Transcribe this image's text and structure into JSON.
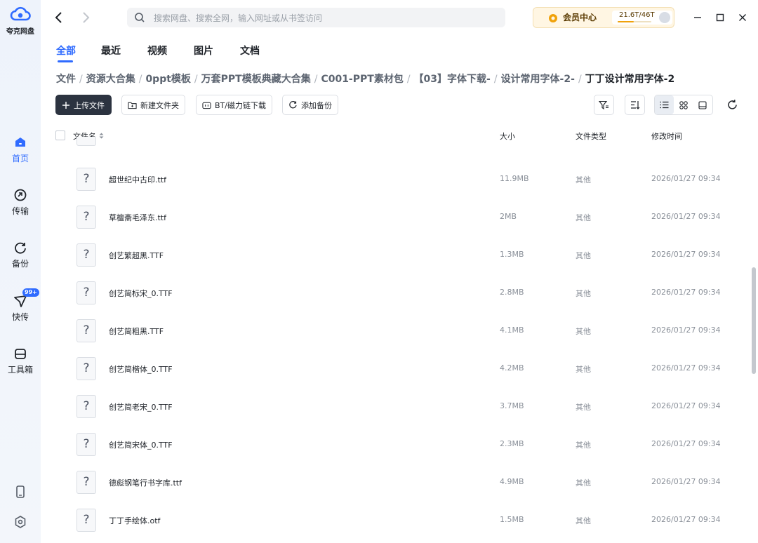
{
  "app": {
    "name": "夸克网盘"
  },
  "sidebar": {
    "items": [
      {
        "label": "首页",
        "icon": "home-icon"
      },
      {
        "label": "传输",
        "icon": "transfer-icon"
      },
      {
        "label": "备份",
        "icon": "backup-icon"
      },
      {
        "label": "快传",
        "icon": "quick-send-icon",
        "badge": "99+"
      },
      {
        "label": "工具箱",
        "icon": "toolbox-icon"
      }
    ],
    "bottom": [
      "phone-icon",
      "settings-icon"
    ]
  },
  "search": {
    "placeholder": "搜索网盘、搜索全网，输入网址或从书签访问"
  },
  "member": {
    "label": "会员中心",
    "storage": "21.6T/46T",
    "storage_used_fraction": 0.47
  },
  "tabs": [
    "全部",
    "最近",
    "视频",
    "图片",
    "文档"
  ],
  "breadcrumb": [
    "文件",
    "资源大合集",
    "0ppt模板",
    "万套PPT模板典藏大合集",
    "C001-PPT素材包",
    "【03】字体下载-",
    "设计常用字体-2-",
    "丁丁设计常用字体-2"
  ],
  "toolbar": {
    "upload": "上传文件",
    "new_folder": "新建文件夹",
    "bt": "BT/磁力链下载",
    "backup": "添加备份"
  },
  "table": {
    "headers": {
      "name": "文件名",
      "size": "大小",
      "type": "文件类型",
      "modified": "修改时间"
    },
    "rows": [
      {
        "name": "超世纪中古印.ttf",
        "size": "11.9MB",
        "type": "其他",
        "modified": "2026/01/27 09:34"
      },
      {
        "name": "草檀斋毛泽东.ttf",
        "size": "2MB",
        "type": "其他",
        "modified": "2026/01/27 09:34"
      },
      {
        "name": "创艺繁超黑.TTF",
        "size": "1.3MB",
        "type": "其他",
        "modified": "2026/01/27 09:34"
      },
      {
        "name": "创艺简标宋_0.TTF",
        "size": "2.8MB",
        "type": "其他",
        "modified": "2026/01/27 09:34"
      },
      {
        "name": "创艺简粗黑.TTF",
        "size": "4.1MB",
        "type": "其他",
        "modified": "2026/01/27 09:34"
      },
      {
        "name": "创艺简楷体_0.TTF",
        "size": "4.2MB",
        "type": "其他",
        "modified": "2026/01/27 09:34"
      },
      {
        "name": "创艺简老宋_0.TTF",
        "size": "3.7MB",
        "type": "其他",
        "modified": "2026/01/27 09:34"
      },
      {
        "name": "创艺简宋体_0.TTF",
        "size": "2.3MB",
        "type": "其他",
        "modified": "2026/01/27 09:34"
      },
      {
        "name": "德彪钢笔行书字库.ttf",
        "size": "4.9MB",
        "type": "其他",
        "modified": "2026/01/27 09:34"
      },
      {
        "name": "丁丁手绘体.otf",
        "size": "1.5MB",
        "type": "其他",
        "modified": "2026/01/27 09:34"
      }
    ]
  },
  "colors": {
    "accent": "#2f6bff",
    "upload_button": "#2c3340",
    "member_bg": "#fff6e3"
  }
}
